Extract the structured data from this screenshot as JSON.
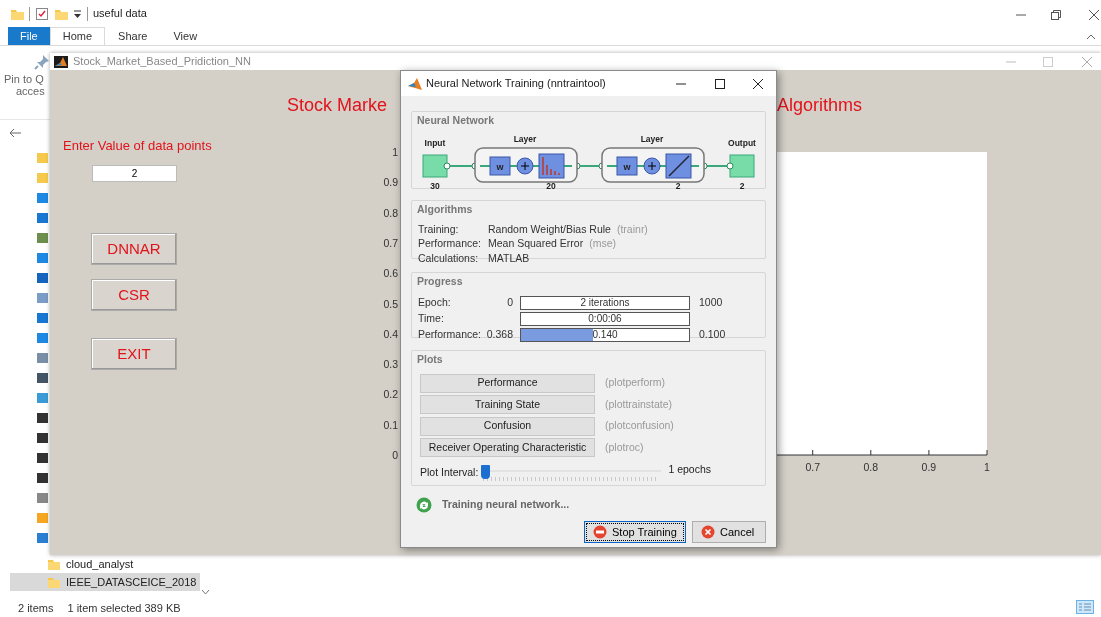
{
  "explorer": {
    "title": "useful data",
    "tabs": [
      {
        "label": "File",
        "kind": "file",
        "selected": false
      },
      {
        "label": "Home",
        "kind": "tab",
        "selected": true
      },
      {
        "label": "Share",
        "kind": "tab",
        "selected": false
      },
      {
        "label": "View",
        "kind": "tab",
        "selected": false
      }
    ],
    "ribbon_texts": [
      "Pin to Q",
      "acces"
    ],
    "nav_items": [
      {
        "label": "cloud_analyst",
        "selected": false
      },
      {
        "label": "IEEE_DATASCEICE_2018",
        "selected": true
      }
    ],
    "status_bar": {
      "count": "2 items",
      "selection": "1 item selected  389 KB"
    }
  },
  "figure": {
    "title": "Stock_Market_Based_Pridiction_NN",
    "heading_parts": [
      "Stock Marke",
      "Algorithms"
    ],
    "prompt": "Enter Value of data points",
    "value": "2",
    "buttons": [
      "DNNAR",
      "CSR",
      "EXIT"
    ],
    "axes": {
      "y_tick_labels": [
        "1",
        "0.9",
        "0.8",
        "0.7",
        "0.6",
        "0.5",
        "0.4",
        "0.3",
        "0.2",
        "0.1",
        "0"
      ],
      "x_tick_labels": [
        "0.7",
        "0.8",
        "0.9",
        "1"
      ]
    }
  },
  "dialog": {
    "title": "Neural Network Training (nntraintool)",
    "network": {
      "heading": "Neural Network",
      "input": {
        "label": "Input",
        "size": "30"
      },
      "layers": [
        {
          "label": "Layer",
          "weight": "w",
          "size": "20",
          "kind": "bars"
        },
        {
          "label": "Layer",
          "weight": "w",
          "size": "2",
          "kind": "line"
        }
      ],
      "output": {
        "label": "Output",
        "size": "2"
      }
    },
    "algorithms": {
      "heading": "Algorithms",
      "rows": [
        {
          "label": "Training:",
          "value": "Random Weight/Bias Rule",
          "function": "(trainr)"
        },
        {
          "label": "Performance:",
          "value": "Mean Squared Error",
          "function": "(mse)"
        },
        {
          "label": "Calculations:",
          "value": "MATLAB"
        }
      ]
    },
    "progress": {
      "heading": "Progress",
      "rows": [
        {
          "label": "Epoch:",
          "start": "0",
          "reading": "2 iterations",
          "end": "1000",
          "level": 0
        },
        {
          "label": "Time:",
          "reading": "0:00:06",
          "level": 0
        },
        {
          "label": "Performance:",
          "start": "0.368",
          "reading": "0.140",
          "end": "0.100",
          "level": 0.43
        }
      ]
    },
    "plots": {
      "heading": "Plots",
      "buttons": [
        {
          "label": "Performance",
          "function": "(plotperform)"
        },
        {
          "label": "Training State",
          "function": "(plottrainstate)"
        },
        {
          "label": "Confusion",
          "function": "(plotconfusion)"
        },
        {
          "label": "Receiver Operating Characteristic",
          "function": "(plotroc)"
        }
      ],
      "interval_label": "Plot Interval:",
      "interval": {
        "level": 0
      },
      "interval_reading": "1 epochs"
    },
    "status": "Training neural network...",
    "buttons": [
      {
        "label": "Stop Training",
        "kind": "stop",
        "focused": true
      },
      {
        "label": "Cancel",
        "kind": "cancel",
        "focused": false
      }
    ]
  }
}
